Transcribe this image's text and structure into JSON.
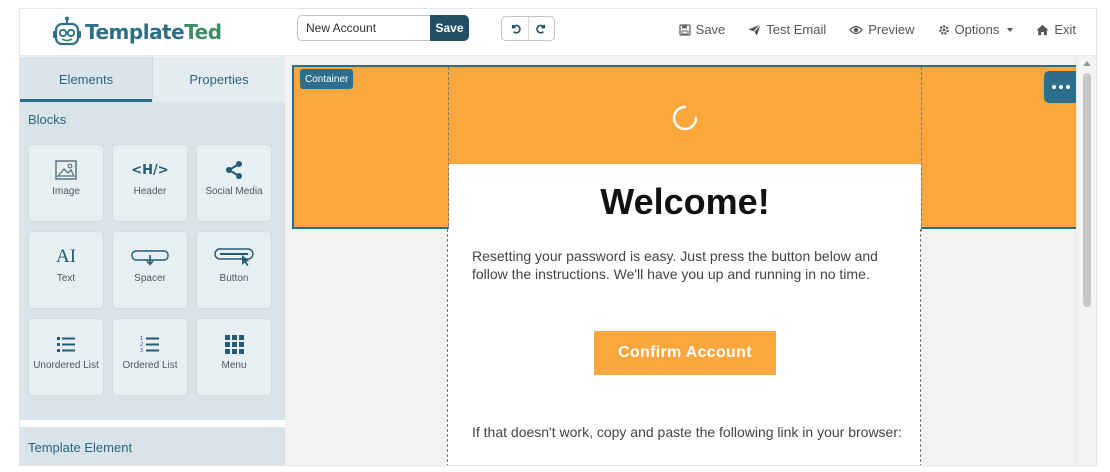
{
  "brand": {
    "part1": "Template",
    "part2": "Ted"
  },
  "toolbar": {
    "template_name": "New Account",
    "name_save_label": "Save",
    "save_label": "Save",
    "test_email_label": "Test Email",
    "preview_label": "Preview",
    "options_label": "Options",
    "exit_label": "Exit"
  },
  "sidebar": {
    "tabs": [
      {
        "label": "Elements"
      },
      {
        "label": "Properties"
      }
    ],
    "blocks_heading": "Blocks",
    "blocks": [
      {
        "label": "Image",
        "icon": "image-icon"
      },
      {
        "label": "Header",
        "icon_text": "<H/>"
      },
      {
        "label": "Social Media",
        "icon": "share-icon"
      },
      {
        "label": "Text",
        "icon_text": "AI"
      },
      {
        "label": "Spacer",
        "icon": "spacer-icon"
      },
      {
        "label": "Button",
        "icon": "button-icon"
      },
      {
        "label": "Unordered List",
        "icon": "unordered-list-icon"
      },
      {
        "label": "Ordered List",
        "icon": "ordered-list-icon"
      },
      {
        "label": "Menu",
        "icon": "grid-icon"
      }
    ],
    "template_element_heading": "Template Element"
  },
  "canvas": {
    "container_tag": "Container",
    "welcome": "Welcome!",
    "paragraph": "Resetting your password is easy. Just press the button below and follow the instructions. We'll have you up and running in no time.",
    "confirm_button": "Confirm Account",
    "paragraph2": "If that doesn't work, copy and paste the following link in your browser:"
  },
  "colors": {
    "accent": "#2d6f8a",
    "orange": "#fba73d",
    "sidebar_bg": "#d9e4e8"
  }
}
